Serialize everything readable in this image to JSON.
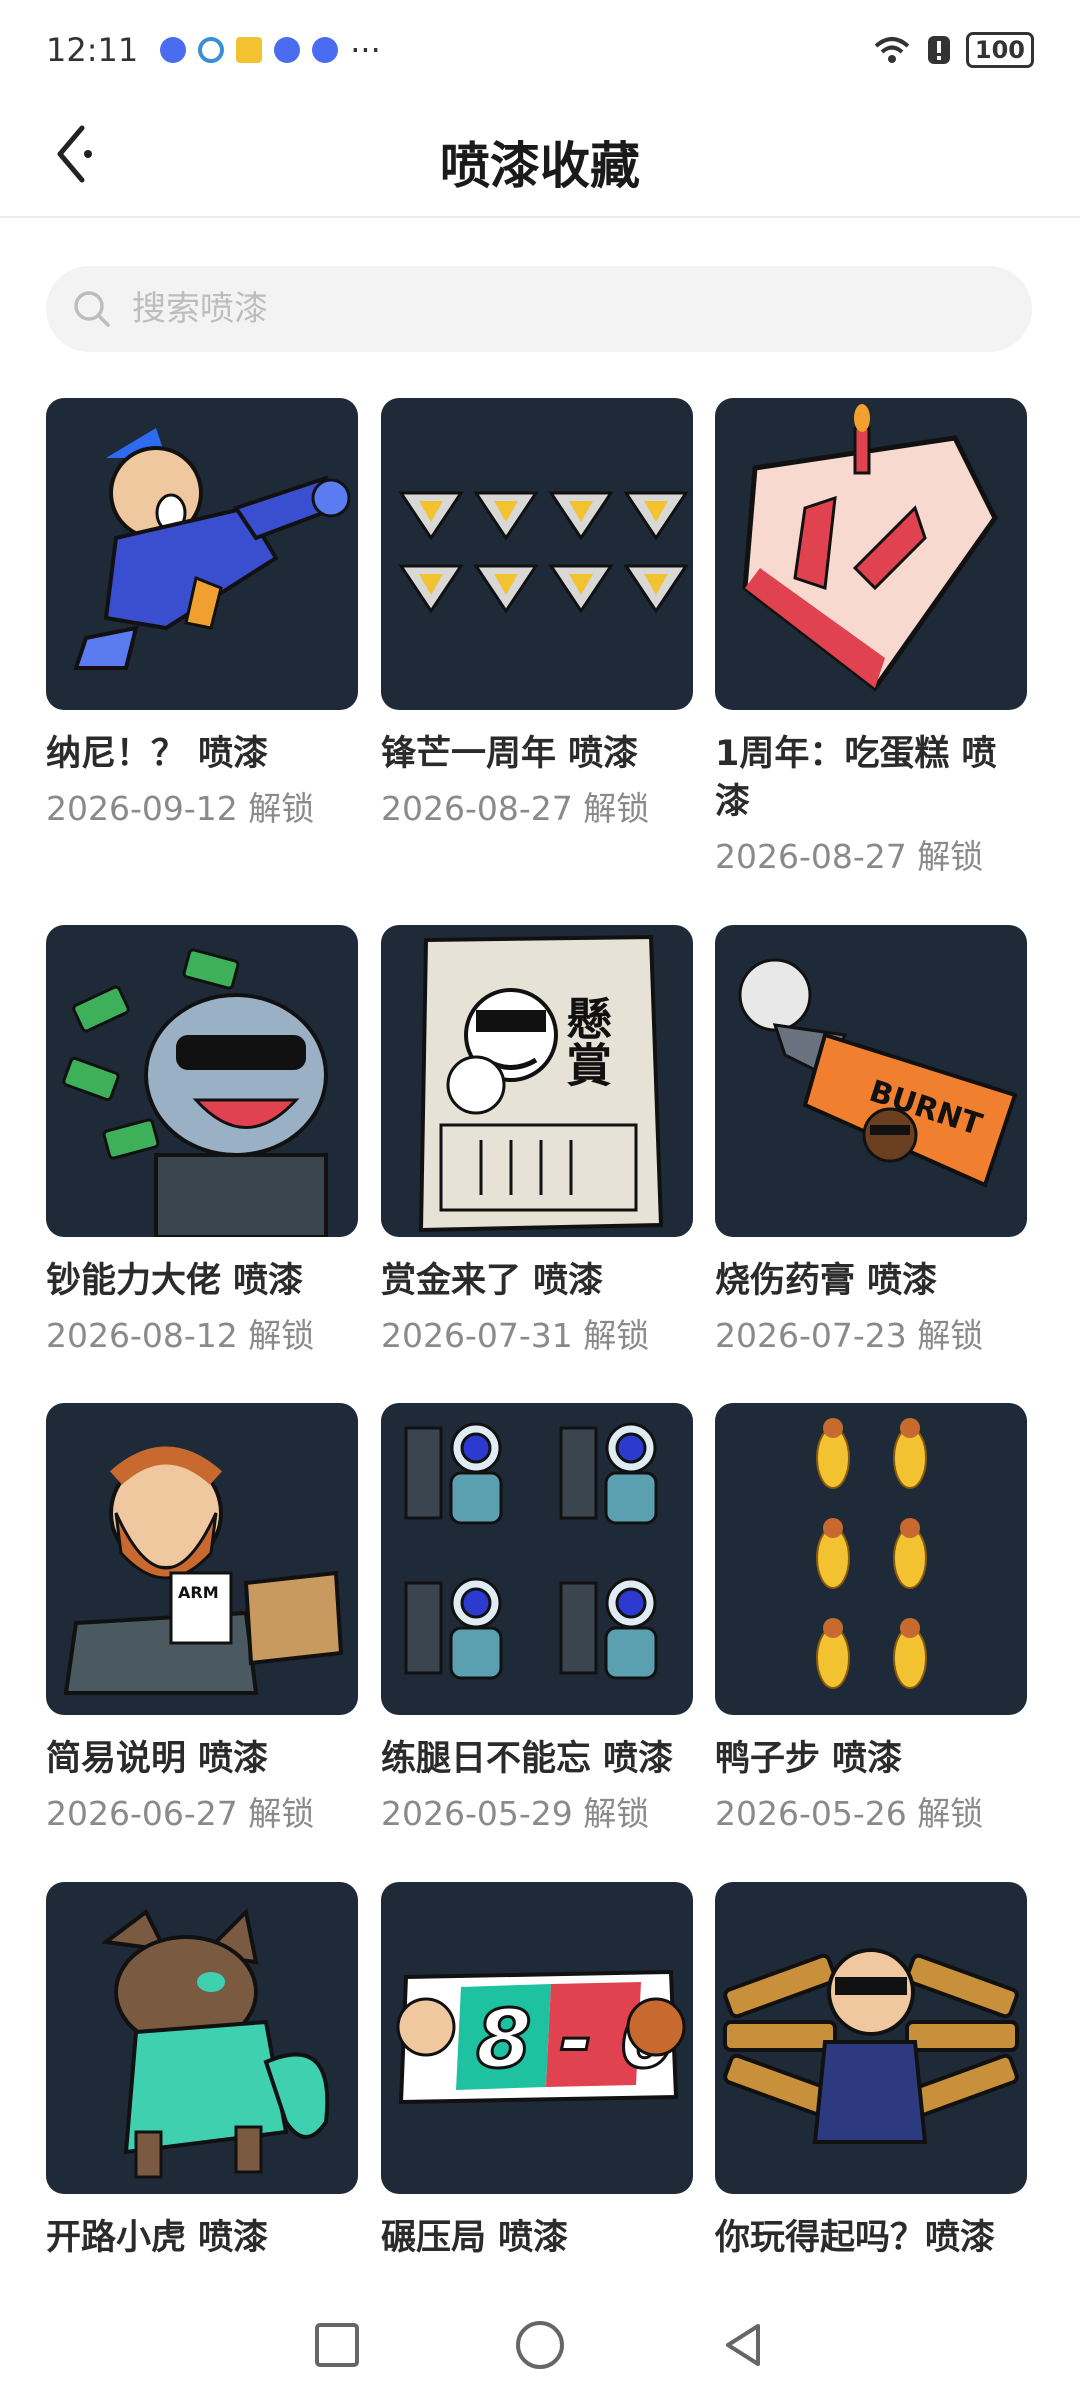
{
  "status_bar": {
    "time": "12:11",
    "more": "···",
    "battery": "100"
  },
  "header": {
    "title": "喷漆收藏"
  },
  "search": {
    "placeholder": "搜索喷漆"
  },
  "sprays": [
    {
      "title": "纳尼！？ 喷漆",
      "date": "2026-09-12 解锁"
    },
    {
      "title": "锋芒一周年 喷漆",
      "date": "2026-08-27 解锁"
    },
    {
      "title": "1周年：吃蛋糕 喷漆",
      "date": "2026-08-27 解锁"
    },
    {
      "title": "钞能力大佬 喷漆",
      "date": "2026-08-12 解锁"
    },
    {
      "title": "赏金来了 喷漆",
      "date": "2026-07-31 解锁"
    },
    {
      "title": "烧伤药膏 喷漆",
      "date": "2026-07-23 解锁"
    },
    {
      "title": "简易说明 喷漆",
      "date": "2026-06-27 解锁"
    },
    {
      "title": "练腿日不能忘 喷漆",
      "date": "2026-05-29 解锁"
    },
    {
      "title": "鸭子步 喷漆",
      "date": "2026-05-26 解锁"
    },
    {
      "title": "开路小虎 喷漆",
      "date": ""
    },
    {
      "title": "碾压局 喷漆",
      "date": ""
    },
    {
      "title": "你玩得起吗？喷漆",
      "date": ""
    }
  ],
  "art_text": {
    "wanted": "懸賞",
    "burnt": "BURNT",
    "score": "8 - 0",
    "arm": "ARM"
  },
  "colors": {
    "thumb_bg": "#1f2a38",
    "accent_red": "#e0434f",
    "accent_teal": "#3fd0b0"
  }
}
